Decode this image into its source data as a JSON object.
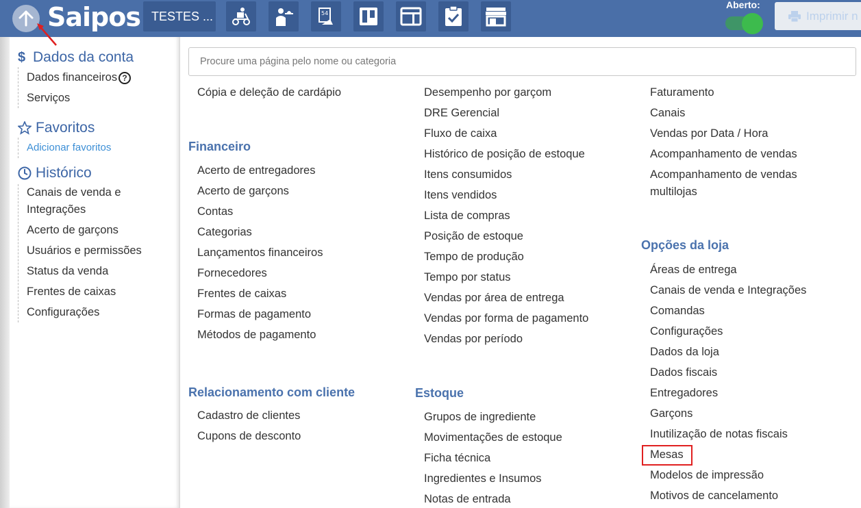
{
  "topbar": {
    "brand": "Saipos",
    "store_button": "TESTES ...",
    "icons": [
      "delivery-icon",
      "waiter-icon",
      "table-card-icon",
      "kanban-icon",
      "panel-icon",
      "checklist-icon",
      "store-icon"
    ],
    "status_label": "Aberto:",
    "print_label": "Imprimir n"
  },
  "sidebar": {
    "account": {
      "title": "Dados da conta",
      "items": [
        "Dados financeiros",
        "Serviços"
      ]
    },
    "favorites": {
      "title": "Favoritos",
      "items": [
        "Adicionar favoritos"
      ]
    },
    "history": {
      "title": "Histórico",
      "items": [
        "Canais de venda e",
        "Integrações",
        "Acerto de garçons",
        "Usuários e permissões",
        "Status da venda",
        "Frentes de caixas",
        "Configurações"
      ]
    }
  },
  "search": {
    "placeholder": "Procure uma página pelo nome ou categoria"
  },
  "columns": {
    "col1": {
      "top_item": "Cópia e deleção de cardápio",
      "financeiro_title": "Financeiro",
      "financeiro": [
        "Acerto de entregadores",
        "Acerto de garçons",
        "Contas",
        "Categorias",
        "Lançamentos financeiros",
        "Fornecedores",
        "Frentes de caixas",
        "Formas de pagamento",
        "Métodos de pagamento"
      ],
      "relacionamento_title": "Relacionamento com cliente",
      "relacionamento": [
        "Cadastro de clientes",
        "Cupons de desconto"
      ]
    },
    "col2": {
      "relatorios": [
        "Desempenho por garçom",
        "DRE Gerencial",
        "Fluxo de caixa",
        "Histórico de posição de estoque",
        "Itens consumidos",
        "Itens vendidos",
        "Lista de compras",
        "Posição de estoque",
        "Tempo de produção",
        "Tempo por status",
        "Vendas por área de entrega",
        "Vendas por forma de pagamento",
        "Vendas por período"
      ],
      "estoque_title": "Estoque",
      "estoque": [
        "Grupos de ingrediente",
        "Movimentações de estoque",
        "Ficha técnica",
        "Ingredientes e Insumos",
        "Notas de entrada"
      ]
    },
    "col3": {
      "relatorios": [
        "Faturamento",
        "Canais",
        "Vendas por Data / Hora",
        "Acompanhamento de vendas",
        "Acompanhamento de vendas",
        "multilojas"
      ],
      "opcoes_title": "Opções da loja",
      "opcoes": [
        "Áreas de entrega",
        "Canais de venda e Integrações",
        "Comandas",
        "Configurações",
        "Dados da loja",
        "Dados fiscais",
        "Entregadores",
        "Garçons",
        "Inutilização de notas fiscais",
        "Mesas",
        "Modelos de impressão",
        "Motivos de cancelamento"
      ]
    }
  },
  "colors": {
    "topbar": "#4a6fa8",
    "category_title": "#4a72ad",
    "highlight_box": "#e02020",
    "toggle_on": "#3dbb4d"
  }
}
